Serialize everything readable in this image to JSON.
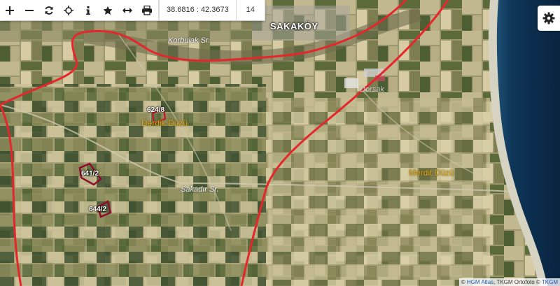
{
  "toolbar": {
    "buttons": [
      {
        "name": "zoom-in-button",
        "icon": "plus-icon"
      },
      {
        "name": "zoom-out-button",
        "icon": "minus-icon"
      },
      {
        "name": "refresh-button",
        "icon": "refresh-icon"
      },
      {
        "name": "locate-button",
        "icon": "crosshair-icon"
      },
      {
        "name": "info-button",
        "icon": "info-icon"
      },
      {
        "name": "favorite-button",
        "icon": "star-icon"
      },
      {
        "name": "measure-button",
        "icon": "arrows-horizontal-icon"
      },
      {
        "name": "print-button",
        "icon": "printer-icon"
      }
    ],
    "coordinates": "38.6816 : 42.3673",
    "zoom_level": "14"
  },
  "settings": {
    "icon": "gear-icon"
  },
  "map": {
    "labels": {
      "village": "SAKAKÖY",
      "road_korbulak": "Korbulak Sr.",
      "road_sakadir": "Sakadır Sr.",
      "region_derdik": "Derdik Düzü",
      "region_merdit": "Merdit Düzü",
      "region_north": "Dorsak"
    },
    "parcels": [
      "624/8",
      "641/2",
      "644/2"
    ],
    "colors": {
      "boundary": "#e5262b",
      "sea": "#0b2a4e",
      "region_label": "#d9a41c"
    }
  },
  "attribution": {
    "prefix": "©",
    "link1": "HGM Atlas",
    "sep1": ", TKGM Ortofoto ©",
    "link2": "TKGM"
  }
}
